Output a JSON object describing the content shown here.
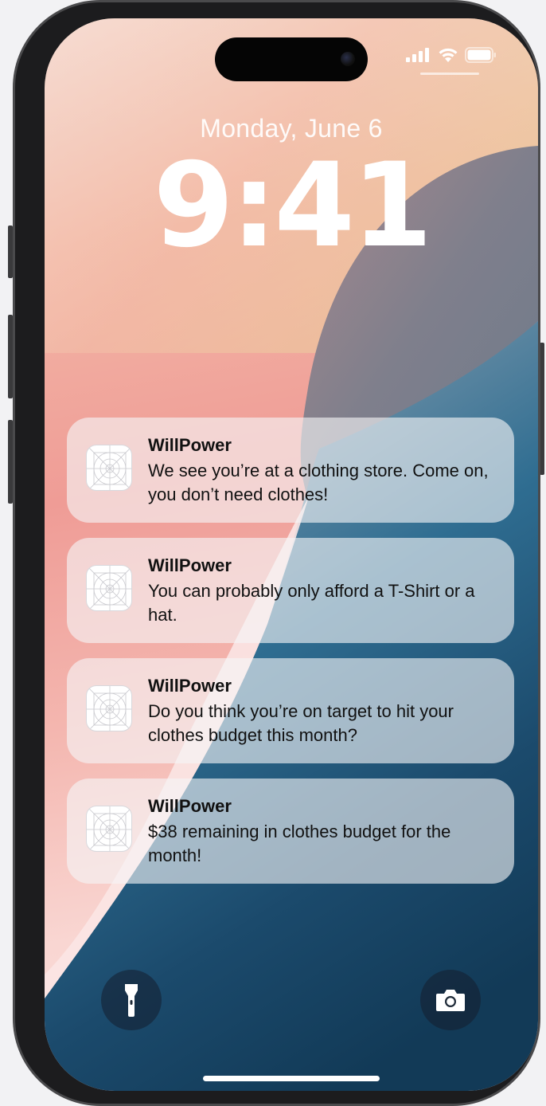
{
  "lockscreen": {
    "date": "Monday, June 6",
    "time": "9:41"
  },
  "status_bar": {
    "signal_icon": "cellular-signal-icon",
    "wifi_icon": "wifi-icon",
    "battery_icon": "battery-icon"
  },
  "notifications": [
    {
      "app": "WillPower",
      "icon": "app-icon-placeholder",
      "message": "We see you’re at a clothing store. Come on, you don’t need clothes!"
    },
    {
      "app": "WillPower",
      "icon": "app-icon-placeholder",
      "message": "You can probably only afford a T-Shirt or a hat."
    },
    {
      "app": "WillPower",
      "icon": "app-icon-placeholder",
      "message": "Do you think you’re on target to hit your clothes budget this month?"
    },
    {
      "app": "WillPower",
      "icon": "app-icon-placeholder",
      "message": "$38 remaining in clothes budget for the month!"
    }
  ],
  "controls": {
    "left_icon": "flashlight-icon",
    "right_icon": "camera-icon"
  },
  "colors": {
    "wallpaper_pink": "#ef9c96",
    "wallpaper_blue": "#1d4f73",
    "wallpaper_gold": "#e8d59a"
  }
}
